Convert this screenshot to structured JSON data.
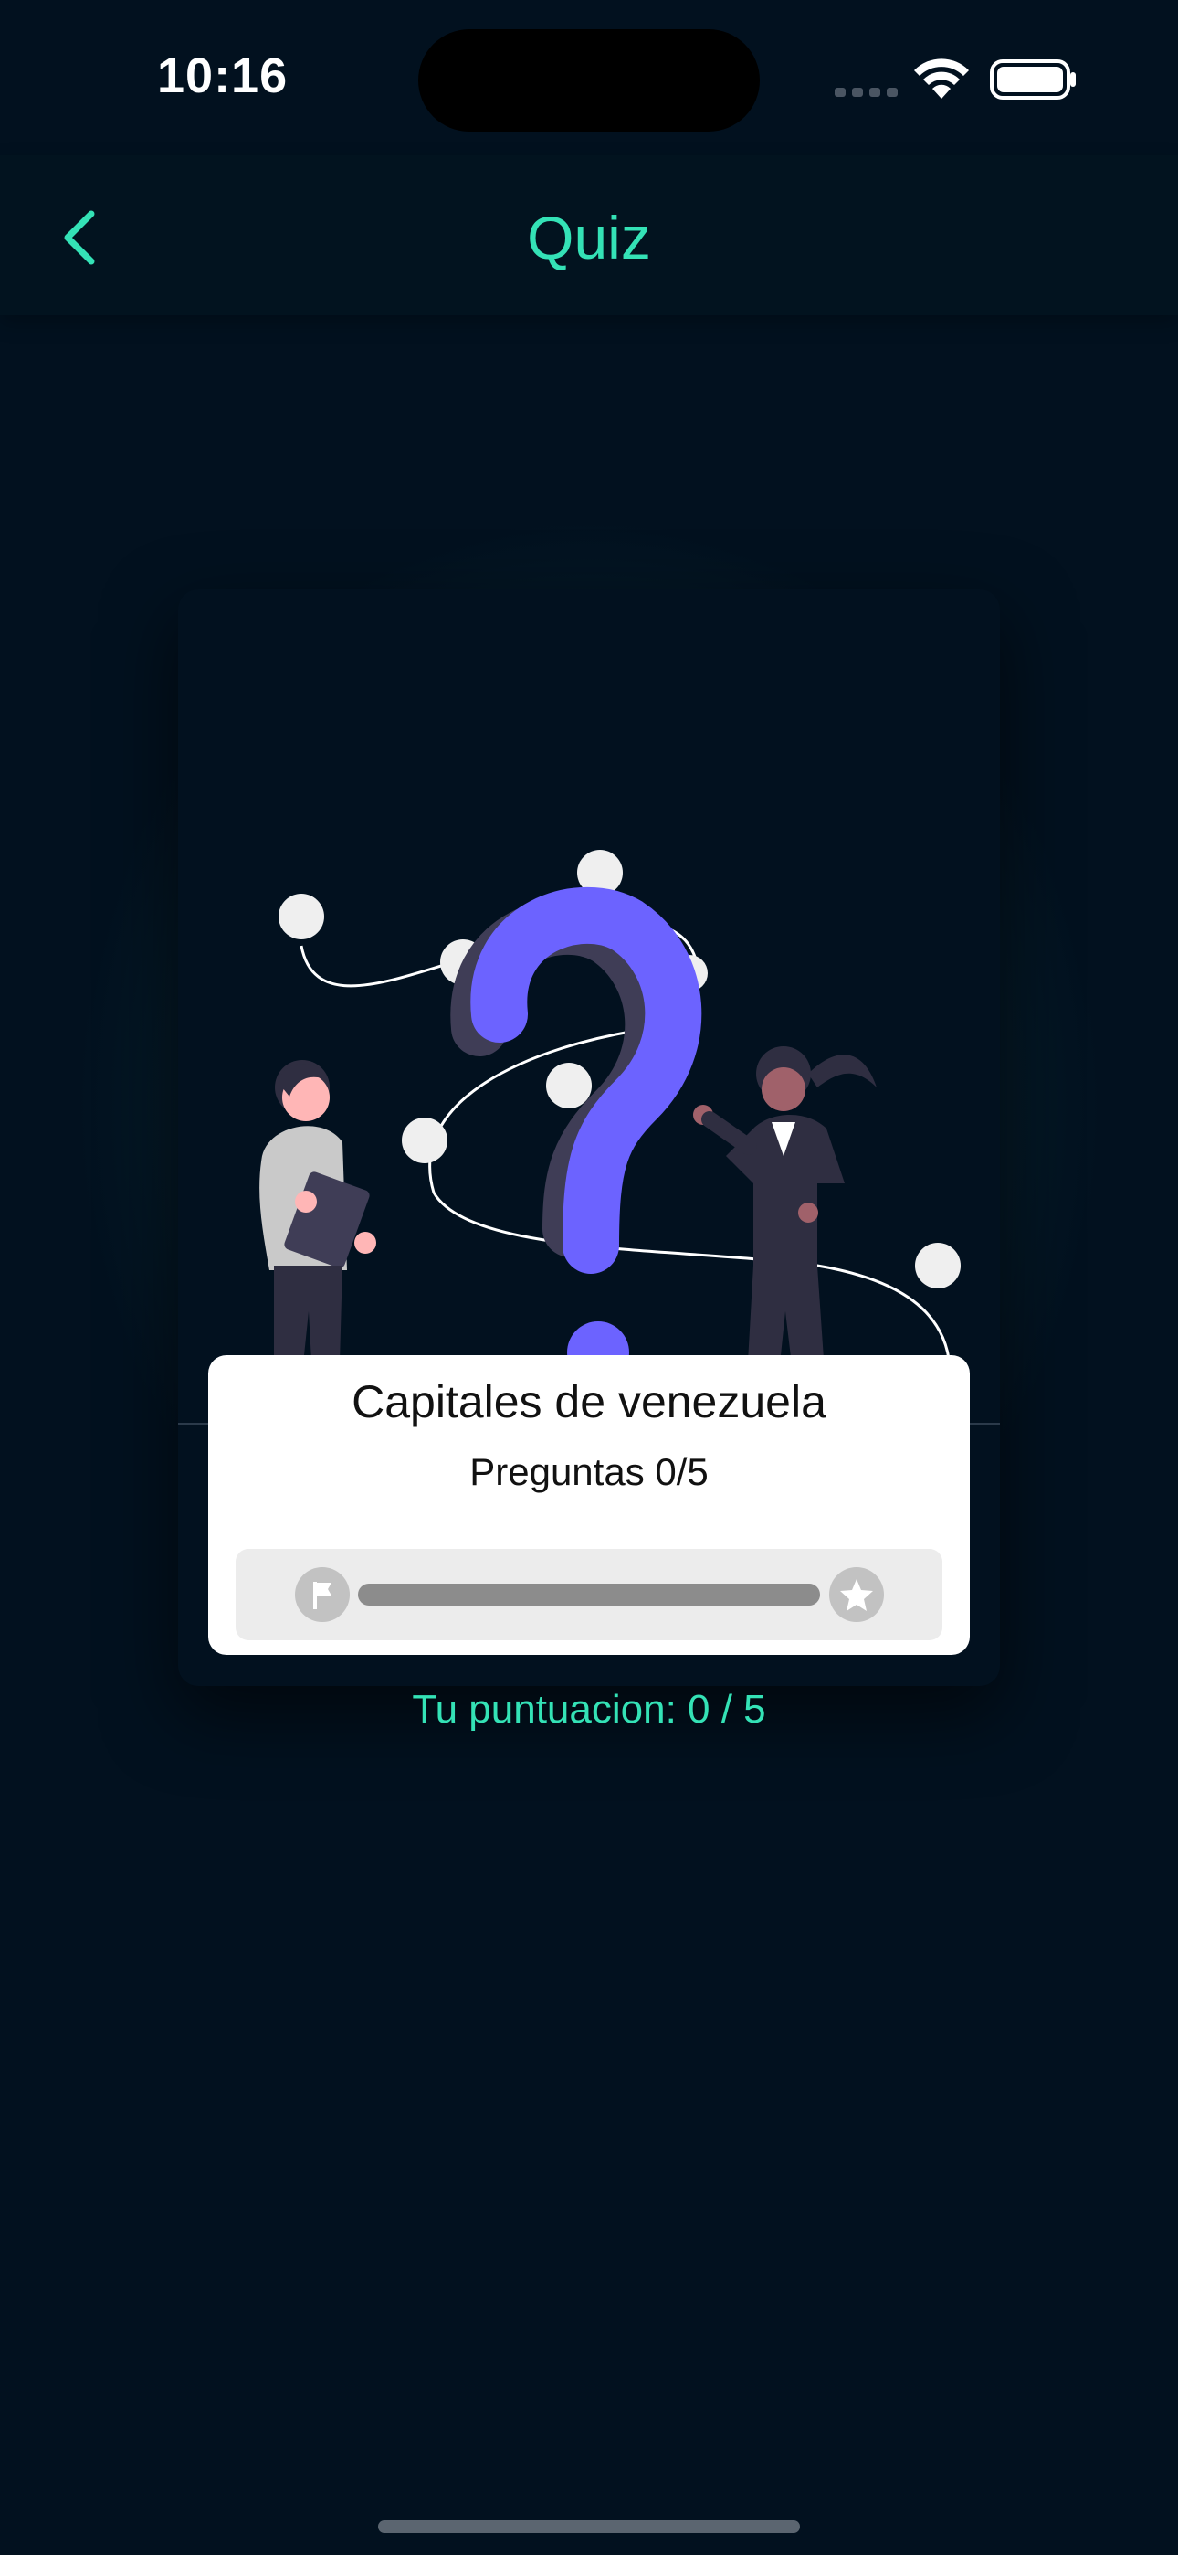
{
  "status_bar": {
    "time": "10:16",
    "icons": [
      "signal-icon",
      "wifi-icon",
      "battery-icon"
    ]
  },
  "nav": {
    "title": "Quiz",
    "back_icon": "chevron-left-icon"
  },
  "quiz": {
    "illustration": "question-mark-people-illustration",
    "title": "Capitales de venezuela",
    "questions_label": "Preguntas 0/5",
    "progress": 0,
    "progress_start_icon": "flag-icon",
    "progress_end_icon": "star-icon",
    "score_label": "Tu puntuacion: 0 / 5"
  },
  "colors": {
    "accent": "#34e2b6",
    "background": "#02111f",
    "question_mark": "#6c63ff"
  }
}
